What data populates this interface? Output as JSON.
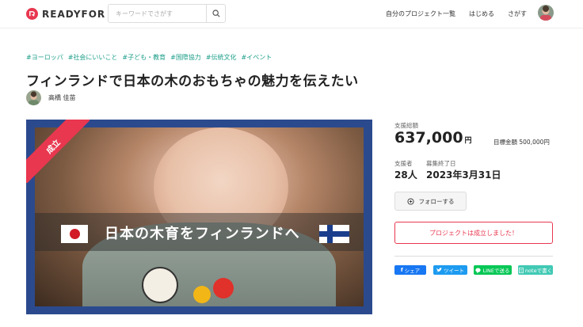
{
  "header": {
    "logo_text": "READYFOR",
    "search_placeholder": "キーワードでさがす",
    "nav": [
      "自分のプロジェクト一覧",
      "はじめる",
      "さがす"
    ]
  },
  "project": {
    "tags": [
      "#ヨーロッパ",
      "#社会にいいこと",
      "#子ども・教育",
      "#国際協力",
      "#伝統文化",
      "#イベント"
    ],
    "title": "フィンランドで日本の木のおもちゃの魅力を伝えたい",
    "owner": "高橋 佳苗",
    "ribbon": "成立",
    "image_caption": "日本の木育をフィンランドへ"
  },
  "stats": {
    "total_label": "支援総額",
    "amount": "637,000",
    "currency": "円",
    "goal_text": "目標金額 500,000円",
    "supporters_label": "支援者",
    "supporters": "28人",
    "end_label": "募集終了日",
    "end_date": "2023年3月31日"
  },
  "actions": {
    "follow": "フォローする",
    "success_message": "プロジェクトは成立しました！",
    "share": [
      "シェア",
      "ツイート",
      "LINEで送る",
      "noteで書く"
    ]
  },
  "colors": {
    "brand": "#e8374f",
    "tag": "#1b9e88",
    "hero_frame": "#2b4a8e"
  }
}
